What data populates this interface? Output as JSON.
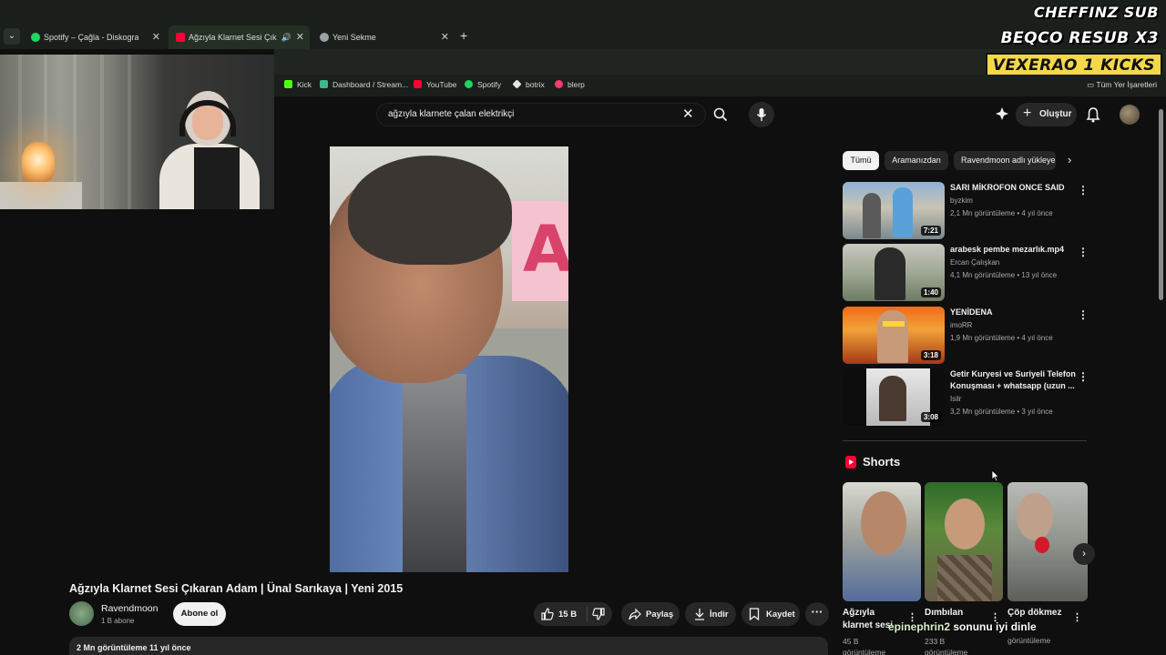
{
  "browser": {
    "tabs": [
      {
        "title": "Spotify – Çağla - Diskografi",
        "favicon_color": "#1ed760"
      },
      {
        "title": "Ağzıyla Klarnet Sesi Çıkaran",
        "favicon_color": "#ff0033"
      },
      {
        "title": "Yeni Sekme",
        "favicon_color": "#9aa0a6"
      }
    ],
    "bookmarks": [
      {
        "label": "Kick",
        "color": "#53fc18"
      },
      {
        "label": "Dashboard / Stream...",
        "color": "#3fb68b"
      },
      {
        "label": "YouTube",
        "color": "#ff0033"
      },
      {
        "label": "Spotify",
        "color": "#1ed760"
      },
      {
        "label": "botrix",
        "color": "#e6e6e6"
      },
      {
        "label": "blerp",
        "color": "#ff3b6b"
      }
    ],
    "all_bookmarks_label": "Tüm Yer İşaretleri"
  },
  "stream_overlay": {
    "line1": "CHEFFINZ  SUB",
    "line2": "BEQCO  RESUB X3",
    "line3": "VEXERAO  1 KICKS"
  },
  "youtube": {
    "search": {
      "value": "ağzıyla klarnete çalan elektrikçi"
    },
    "create_label": "Oluştur",
    "video": {
      "title": "Ağzıyla Klarnet Sesi Çıkaran Adam | Ünal Sarıkaya | Yeni 2015",
      "channel": "Ravendmoon",
      "subscribers": "1 B abone",
      "subscribe_label": "Abone ol",
      "likes": "15 B",
      "share_label": "Paylaş",
      "download_label": "İndir",
      "save_label": "Kaydet",
      "stats": "2 Mn görüntüleme  11 yıl önce"
    },
    "chips": [
      "Tümü",
      "Aramanızdan",
      "Ravendmoon adlı yükleyen"
    ],
    "recommendations": [
      {
        "title": "SARI MİKROFON ONCE SAID",
        "channel": "byzkim",
        "meta": "2,1 Mn görüntüleme • 4 yıl önce",
        "duration": "7:21"
      },
      {
        "title": "arabesk pembe mezarlık.mp4",
        "channel": "Ercan Çalışkan",
        "meta": "4,1 Mn görüntüleme • 13 yıl önce",
        "duration": "1:40"
      },
      {
        "title": "YENİDENA",
        "channel": "imoRR",
        "meta": "1,9 Mn görüntüleme • 4 yıl önce",
        "duration": "3:18"
      },
      {
        "title": "Getir Kuryesi ve Suriyeli Telefon Konuşması + whatsapp (uzun ...",
        "channel": "Isilr",
        "meta": "3,2 Mn görüntüleme • 3 yıl önce",
        "duration": "3:08"
      }
    ],
    "shorts_heading": "Shorts",
    "shorts": [
      {
        "title": "Ağzıyla klarnet sesi",
        "views": "45 B",
        "views_suffix": "görüntüleme"
      },
      {
        "title": "Dımbılan",
        "views": "233 B",
        "views_suffix": "görüntüleme"
      },
      {
        "title": "Çöp dökmez",
        "views": "",
        "views_suffix": "görüntüleme"
      }
    ]
  },
  "chat_overlay": {
    "user": "epinephrin2",
    "message": "sonunu iyi dinle"
  }
}
